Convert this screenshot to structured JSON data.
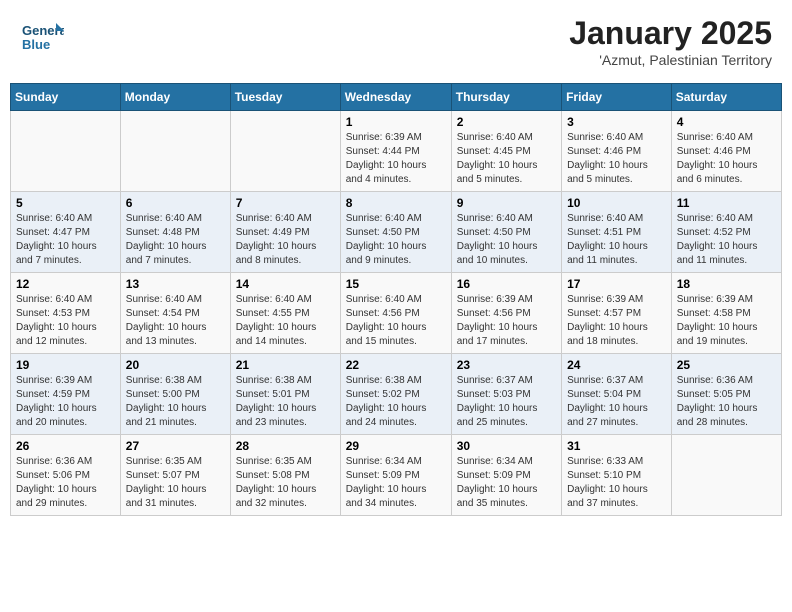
{
  "header": {
    "logo_text_general": "General",
    "logo_text_blue": "Blue",
    "title": "January 2025",
    "subtitle": "'Azmut, Palestinian Territory"
  },
  "calendar": {
    "days_of_week": [
      "Sunday",
      "Monday",
      "Tuesday",
      "Wednesday",
      "Thursday",
      "Friday",
      "Saturday"
    ],
    "weeks": [
      [
        {
          "day": "",
          "info": ""
        },
        {
          "day": "",
          "info": ""
        },
        {
          "day": "",
          "info": ""
        },
        {
          "day": "1",
          "info": "Sunrise: 6:39 AM\nSunset: 4:44 PM\nDaylight: 10 hours and 4 minutes."
        },
        {
          "day": "2",
          "info": "Sunrise: 6:40 AM\nSunset: 4:45 PM\nDaylight: 10 hours and 5 minutes."
        },
        {
          "day": "3",
          "info": "Sunrise: 6:40 AM\nSunset: 4:46 PM\nDaylight: 10 hours and 5 minutes."
        },
        {
          "day": "4",
          "info": "Sunrise: 6:40 AM\nSunset: 4:46 PM\nDaylight: 10 hours and 6 minutes."
        }
      ],
      [
        {
          "day": "5",
          "info": "Sunrise: 6:40 AM\nSunset: 4:47 PM\nDaylight: 10 hours and 7 minutes."
        },
        {
          "day": "6",
          "info": "Sunrise: 6:40 AM\nSunset: 4:48 PM\nDaylight: 10 hours and 7 minutes."
        },
        {
          "day": "7",
          "info": "Sunrise: 6:40 AM\nSunset: 4:49 PM\nDaylight: 10 hours and 8 minutes."
        },
        {
          "day": "8",
          "info": "Sunrise: 6:40 AM\nSunset: 4:50 PM\nDaylight: 10 hours and 9 minutes."
        },
        {
          "day": "9",
          "info": "Sunrise: 6:40 AM\nSunset: 4:50 PM\nDaylight: 10 hours and 10 minutes."
        },
        {
          "day": "10",
          "info": "Sunrise: 6:40 AM\nSunset: 4:51 PM\nDaylight: 10 hours and 11 minutes."
        },
        {
          "day": "11",
          "info": "Sunrise: 6:40 AM\nSunset: 4:52 PM\nDaylight: 10 hours and 11 minutes."
        }
      ],
      [
        {
          "day": "12",
          "info": "Sunrise: 6:40 AM\nSunset: 4:53 PM\nDaylight: 10 hours and 12 minutes."
        },
        {
          "day": "13",
          "info": "Sunrise: 6:40 AM\nSunset: 4:54 PM\nDaylight: 10 hours and 13 minutes."
        },
        {
          "day": "14",
          "info": "Sunrise: 6:40 AM\nSunset: 4:55 PM\nDaylight: 10 hours and 14 minutes."
        },
        {
          "day": "15",
          "info": "Sunrise: 6:40 AM\nSunset: 4:56 PM\nDaylight: 10 hours and 15 minutes."
        },
        {
          "day": "16",
          "info": "Sunrise: 6:39 AM\nSunset: 4:56 PM\nDaylight: 10 hours and 17 minutes."
        },
        {
          "day": "17",
          "info": "Sunrise: 6:39 AM\nSunset: 4:57 PM\nDaylight: 10 hours and 18 minutes."
        },
        {
          "day": "18",
          "info": "Sunrise: 6:39 AM\nSunset: 4:58 PM\nDaylight: 10 hours and 19 minutes."
        }
      ],
      [
        {
          "day": "19",
          "info": "Sunrise: 6:39 AM\nSunset: 4:59 PM\nDaylight: 10 hours and 20 minutes."
        },
        {
          "day": "20",
          "info": "Sunrise: 6:38 AM\nSunset: 5:00 PM\nDaylight: 10 hours and 21 minutes."
        },
        {
          "day": "21",
          "info": "Sunrise: 6:38 AM\nSunset: 5:01 PM\nDaylight: 10 hours and 23 minutes."
        },
        {
          "day": "22",
          "info": "Sunrise: 6:38 AM\nSunset: 5:02 PM\nDaylight: 10 hours and 24 minutes."
        },
        {
          "day": "23",
          "info": "Sunrise: 6:37 AM\nSunset: 5:03 PM\nDaylight: 10 hours and 25 minutes."
        },
        {
          "day": "24",
          "info": "Sunrise: 6:37 AM\nSunset: 5:04 PM\nDaylight: 10 hours and 27 minutes."
        },
        {
          "day": "25",
          "info": "Sunrise: 6:36 AM\nSunset: 5:05 PM\nDaylight: 10 hours and 28 minutes."
        }
      ],
      [
        {
          "day": "26",
          "info": "Sunrise: 6:36 AM\nSunset: 5:06 PM\nDaylight: 10 hours and 29 minutes."
        },
        {
          "day": "27",
          "info": "Sunrise: 6:35 AM\nSunset: 5:07 PM\nDaylight: 10 hours and 31 minutes."
        },
        {
          "day": "28",
          "info": "Sunrise: 6:35 AM\nSunset: 5:08 PM\nDaylight: 10 hours and 32 minutes."
        },
        {
          "day": "29",
          "info": "Sunrise: 6:34 AM\nSunset: 5:09 PM\nDaylight: 10 hours and 34 minutes."
        },
        {
          "day": "30",
          "info": "Sunrise: 6:34 AM\nSunset: 5:09 PM\nDaylight: 10 hours and 35 minutes."
        },
        {
          "day": "31",
          "info": "Sunrise: 6:33 AM\nSunset: 5:10 PM\nDaylight: 10 hours and 37 minutes."
        },
        {
          "day": "",
          "info": ""
        }
      ]
    ]
  }
}
